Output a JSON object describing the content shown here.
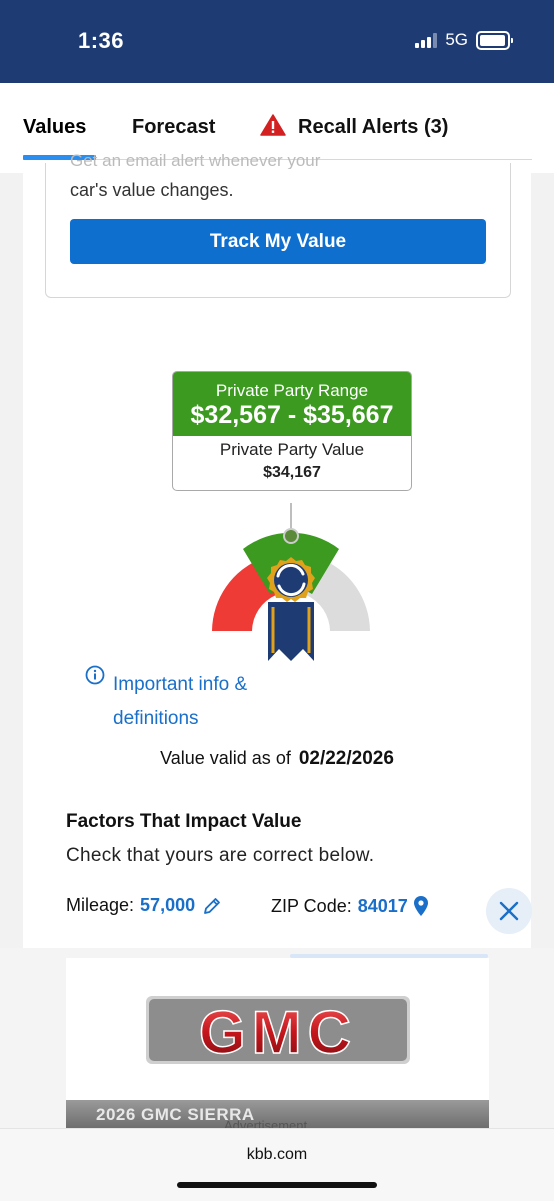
{
  "status": {
    "time": "1:36",
    "network": "5G"
  },
  "tabs": [
    {
      "label": "Values",
      "active": true
    },
    {
      "label": "Forecast",
      "active": false
    },
    {
      "label": "Recall Alerts (3)",
      "active": false
    }
  ],
  "track": {
    "faded_text": "Get an email alert whenever your",
    "description": "car's value changes.",
    "button_label": "Track My Value"
  },
  "value": {
    "range_title": "Private Party Range",
    "range": "$32,567 - $35,667",
    "ppv_title": "Private Party Value",
    "ppv": "$34,167"
  },
  "info": {
    "link_text": "Important info & definitions"
  },
  "valid": {
    "label": "Value valid as of",
    "date": "02/22/2026"
  },
  "factors": {
    "title": "Factors That Impact Value",
    "subtitle": "Check that yours are correct below.",
    "mileage_label": "Mileage:",
    "mileage_value": "57,000",
    "zip_label": "ZIP Code:",
    "zip_value": "84017"
  },
  "ad": {
    "brand": "GMC",
    "strip_text": "2026 GMC SIERRA",
    "label": "Advertisement"
  },
  "browser": {
    "url": "kbb.com"
  },
  "colors": {
    "header": "#1f3b73",
    "accent": "#0f6fcf",
    "range_green": "#3b9a1f",
    "link": "#1a6fc9"
  }
}
